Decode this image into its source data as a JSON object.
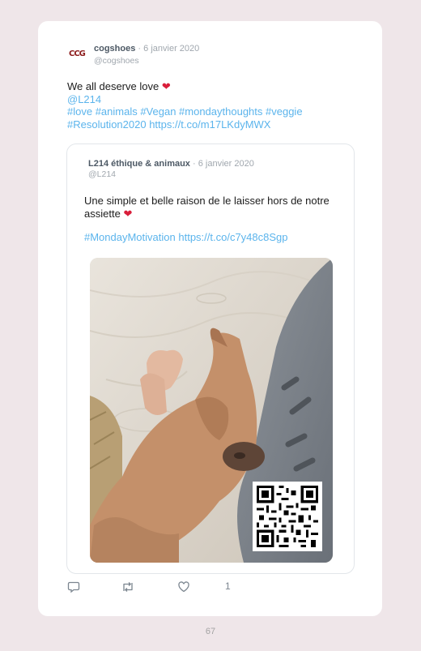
{
  "tweet": {
    "logo_text": "CCG",
    "author_name": "cogshoes",
    "date": "6 janvier 2020",
    "handle": "@cogshoes",
    "text_line1": "We all deserve love",
    "mention": "@L214",
    "hashtags_line1": "#love #animals #Vegan #mondaythoughts #veggie",
    "hashtag_line2": "#Resolution2020",
    "link": "https://t.co/m17LKdyMWX",
    "like_count": "1"
  },
  "quoted_tweet": {
    "author_name": "L214 éthique & animaux",
    "date": "6 janvier 2020",
    "handle": "@L214",
    "text": "Une simple et belle raison de le laisser hors de notre assiette",
    "hashtag": "#MondayMotivation",
    "link": "https://t.co/c7y48c8Sgp"
  },
  "page_number": "67",
  "colors": {
    "page_background": "#efe6e9",
    "link_blue": "#5bb4ec",
    "heart_red": "#d91e3a",
    "logo_red": "#8b1a1a"
  },
  "icons": [
    "reply-icon",
    "retweet-icon",
    "like-icon",
    "heart-emoji"
  ]
}
